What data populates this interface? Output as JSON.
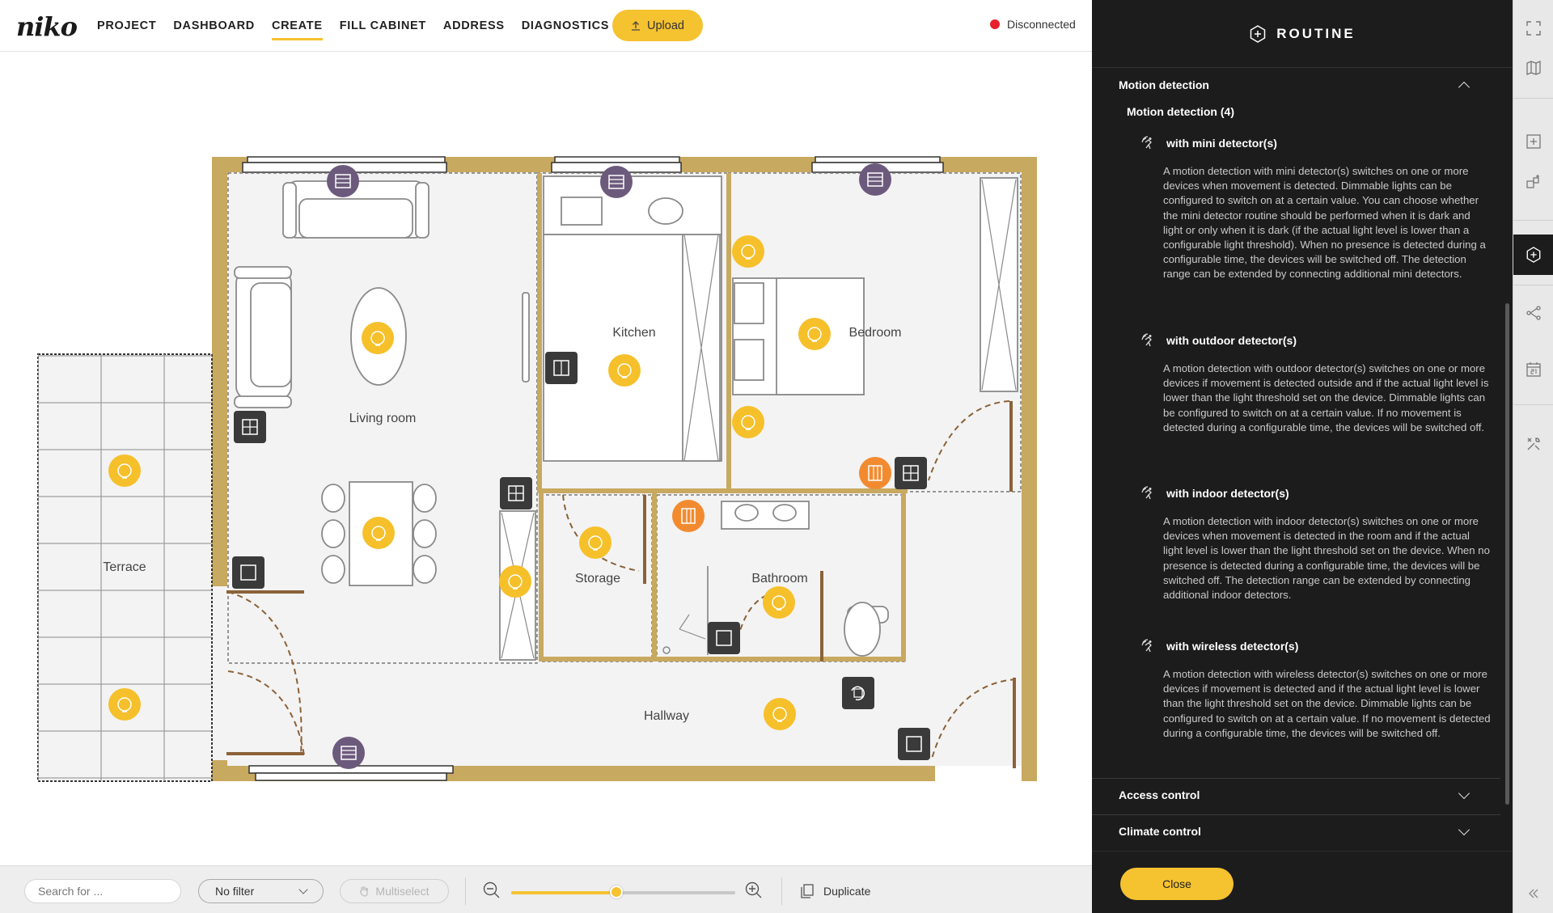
{
  "app": {
    "logo": "niko"
  },
  "nav": {
    "items": [
      {
        "label": "PROJECT",
        "active": false
      },
      {
        "label": "DASHBOARD",
        "active": false
      },
      {
        "label": "CREATE",
        "active": true
      },
      {
        "label": "FILL CABINET",
        "active": false
      },
      {
        "label": "ADDRESS",
        "active": false
      },
      {
        "label": "DIAGNOSTICS",
        "active": false
      }
    ],
    "upload_label": "Upload"
  },
  "connection": {
    "status": "Disconnected",
    "color": "#e8202a"
  },
  "floorplan": {
    "rooms": [
      "Living room",
      "Kitchen",
      "Bedroom",
      "Terrace",
      "Storage",
      "Bathroom",
      "Hallway"
    ]
  },
  "toolbar": {
    "search_placeholder": "Search for ...",
    "filter_value": "No filter",
    "multiselect_label": "Multiselect",
    "zoom_level": 0.47,
    "duplicate_label": "Duplicate"
  },
  "panel": {
    "title": "ROUTINE",
    "section_motion": "Motion detection",
    "subsection": "Motion detection (4)",
    "routines": [
      {
        "title": "with mini detector(s)",
        "description": "A motion detection with mini detector(s) switches on one or more devices when movement is detected. Dimmable lights can be configured to switch on at a certain value. You can choose whether the mini detector routine should be performed when it is dark and light or only when it is dark (if the actual light level is lower than a configurable light threshold). When no presence is detected during a configurable time, the devices will be switched off. The detection range can be extended by connecting additional mini detectors."
      },
      {
        "title": "with outdoor detector(s)",
        "description": "A motion detection with outdoor detector(s) switches on one or more devices if movement is detected outside and if the actual light level is lower than the light threshold set on the device. Dimmable lights can be configured to switch on at a certain value. If no movement is detected during a configurable time, the devices will be switched off."
      },
      {
        "title": "with indoor detector(s)",
        "description": "A motion detection with indoor detector(s) switches on one or more devices when movement is detected in the room and if the actual light level is lower than the light threshold set on the device. When no presence is detected during a configurable time, the devices will be switched off. The detection range can be extended by connecting additional indoor detectors."
      },
      {
        "title": "with wireless detector(s)",
        "description": "A motion detection with wireless detector(s) switches on one or more devices if movement is detected and if the actual light level is lower than the light threshold set on the device. Dimmable lights can be configured to switch on at a certain value. If no movement is detected during a configurable time, the devices will be switched off."
      }
    ],
    "section_access": "Access control",
    "section_climate": "Climate control",
    "close_label": "Close"
  },
  "colors": {
    "accent": "#f5c230",
    "wall": "#c8a960",
    "panel_bg": "#1c1c1c",
    "light_device": "#f6c02b",
    "blind_device": "#6c5a7c",
    "orange_device": "#f28b30",
    "switch_device": "#3a3a3a"
  },
  "rail_icons": [
    "fullscreen-icon",
    "map-icon",
    "add-device-icon",
    "devices-icon",
    "routine-icon",
    "connections-icon",
    "calendar-icon",
    "tools-icon",
    "collapse-icon"
  ]
}
